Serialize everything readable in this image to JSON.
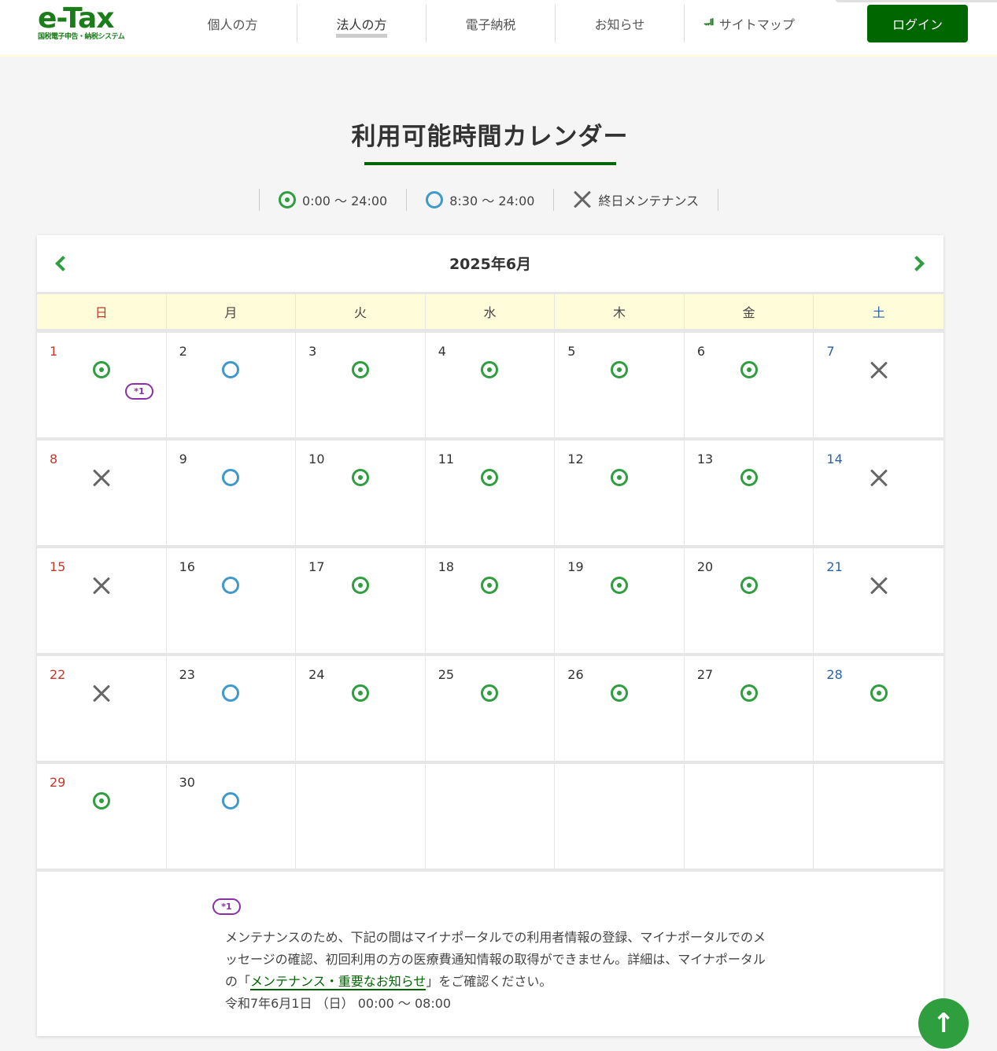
{
  "header": {
    "logo_main": "e-Tax",
    "logo_sub": "国税電子申告・納税システム",
    "nav": [
      {
        "label": "個人の方",
        "key": "individual"
      },
      {
        "label": "法人の方",
        "key": "corporate"
      },
      {
        "label": "電子納税",
        "key": "payment"
      },
      {
        "label": "お知らせ",
        "key": "news"
      },
      {
        "label": "サイトマップ",
        "key": "sitemap"
      }
    ],
    "login_label": "ログイン"
  },
  "page": {
    "title": "利用可能時間カレンダー"
  },
  "legend": {
    "full": "0:00 〜 24:00",
    "partial": "8:30 〜 24:00",
    "maintenance": "終日メンテナンス"
  },
  "calendar": {
    "month_label": "2025年6月",
    "weekdays": [
      "日",
      "月",
      "火",
      "水",
      "木",
      "金",
      "土"
    ],
    "days": [
      {
        "day": "1",
        "status": "full",
        "note": "*1"
      },
      {
        "day": "2",
        "status": "partial"
      },
      {
        "day": "3",
        "status": "full"
      },
      {
        "day": "4",
        "status": "full"
      },
      {
        "day": "5",
        "status": "full"
      },
      {
        "day": "6",
        "status": "full"
      },
      {
        "day": "7",
        "status": "maintenance"
      },
      {
        "day": "8",
        "status": "maintenance"
      },
      {
        "day": "9",
        "status": "partial"
      },
      {
        "day": "10",
        "status": "full"
      },
      {
        "day": "11",
        "status": "full"
      },
      {
        "day": "12",
        "status": "full"
      },
      {
        "day": "13",
        "status": "full"
      },
      {
        "day": "14",
        "status": "maintenance"
      },
      {
        "day": "15",
        "status": "maintenance"
      },
      {
        "day": "16",
        "status": "partial"
      },
      {
        "day": "17",
        "status": "full"
      },
      {
        "day": "18",
        "status": "full"
      },
      {
        "day": "19",
        "status": "full"
      },
      {
        "day": "20",
        "status": "full"
      },
      {
        "day": "21",
        "status": "maintenance"
      },
      {
        "day": "22",
        "status": "maintenance"
      },
      {
        "day": "23",
        "status": "partial"
      },
      {
        "day": "24",
        "status": "full"
      },
      {
        "day": "25",
        "status": "full"
      },
      {
        "day": "26",
        "status": "full"
      },
      {
        "day": "27",
        "status": "full"
      },
      {
        "day": "28",
        "status": "full"
      },
      {
        "day": "29",
        "status": "full"
      },
      {
        "day": "30",
        "status": "partial"
      },
      {
        "day": "",
        "status": ""
      },
      {
        "day": "",
        "status": ""
      },
      {
        "day": "",
        "status": ""
      },
      {
        "day": "",
        "status": ""
      },
      {
        "day": "",
        "status": ""
      }
    ]
  },
  "note": {
    "badge": "*1",
    "text_before": "メンテナンスのため、下記の間はマイナポータルでの利用者情報の登録、マイナポータルでのメッセージの確認、初回利用の方の医療費通知情報の取得ができません。詳細は、マイナポータルの「",
    "link_label": "メンテナンス・重要なお知らせ",
    "text_after": "」をご確認ください。",
    "time": "令和7年6月1日 （日） 00:00 〜 08:00"
  },
  "to_top_label": "↑"
}
